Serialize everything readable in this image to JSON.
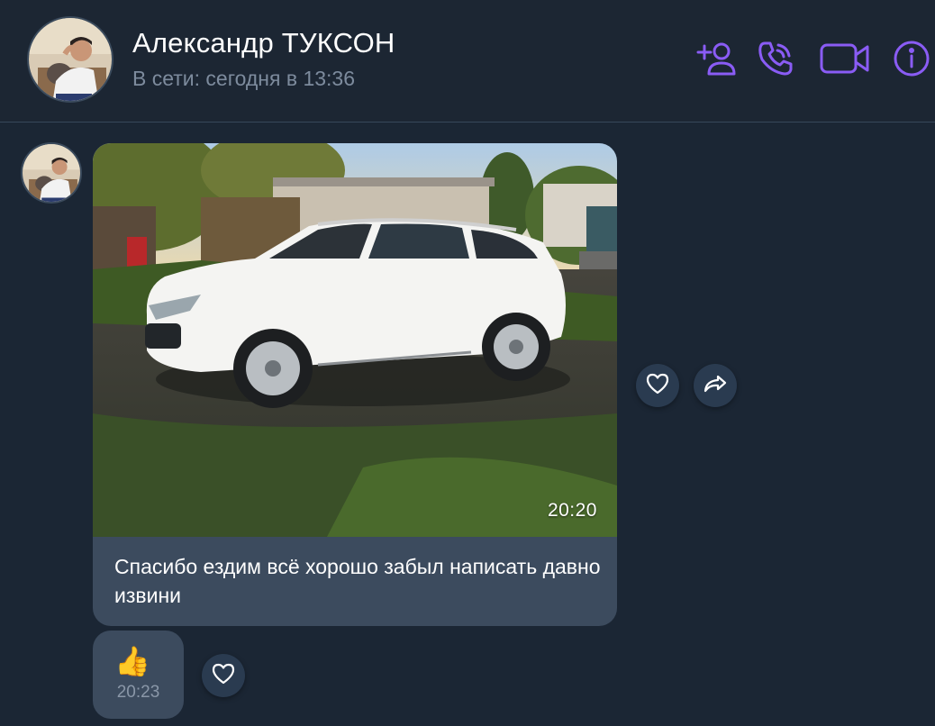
{
  "header": {
    "contact_name": "Александр ТУКСОН",
    "status": "В сети: сегодня в 13:36",
    "actions": [
      {
        "name": "add-contact-icon"
      },
      {
        "name": "voice-call-icon"
      },
      {
        "name": "video-call-icon"
      },
      {
        "name": "info-icon"
      }
    ],
    "accent_color": "#8a5cf5"
  },
  "messages": [
    {
      "type": "photo",
      "time": "20:20",
      "text": "Спасибо ездим всё хорошо забыл написать давно извини",
      "actions": [
        {
          "name": "like-icon"
        },
        {
          "name": "forward-icon"
        }
      ]
    },
    {
      "type": "emoji",
      "emoji": "👍",
      "time": "20:23",
      "actions": [
        {
          "name": "like-icon"
        }
      ]
    }
  ],
  "colors": {
    "background": "#1b2634",
    "bubble": "#3c4b5e",
    "status_text": "#7d8b9d"
  }
}
